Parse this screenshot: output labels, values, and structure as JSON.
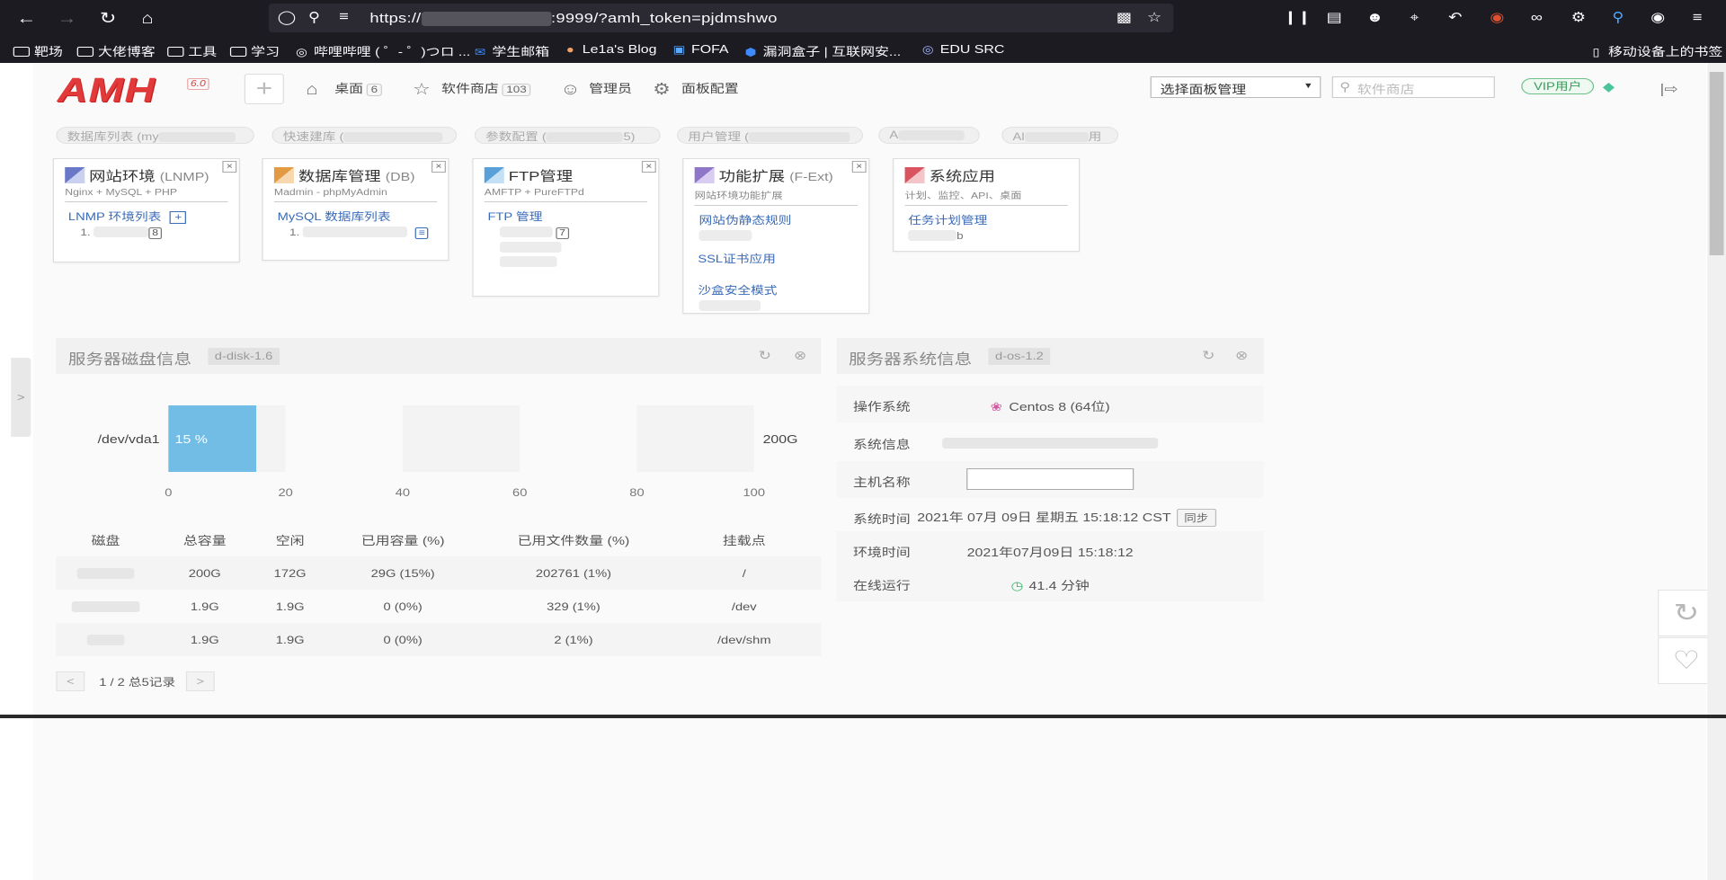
{
  "browser": {
    "url_prefix": "https://",
    "url_suffix": ":9999/?amh_token=pjdmshwo",
    "bookmarks": [
      {
        "label": "靶场",
        "icon": "folder-icon"
      },
      {
        "label": "大佬博客",
        "icon": "folder-icon"
      },
      {
        "label": "工具",
        "icon": "folder-icon"
      },
      {
        "label": "学习",
        "icon": "folder-icon"
      },
      {
        "label": "哔哩哔哩 ( ゜- ゜)つロ ...",
        "icon": "globe-icon"
      },
      {
        "label": "学生邮箱",
        "icon": "mail-icon"
      },
      {
        "label": "Le1a's Blog",
        "icon": "pig-icon"
      },
      {
        "label": "FOFA",
        "icon": "fofa-icon"
      },
      {
        "label": "漏洞盒子 | 互联网安...",
        "icon": "shield-icon"
      },
      {
        "label": "EDU SRC",
        "icon": "globe-icon"
      }
    ],
    "mobile_bookmarks": "移动设备上的书签"
  },
  "header": {
    "logo": "AMH",
    "version": "6.0",
    "nav": [
      {
        "label": "桌面",
        "count": "6",
        "icon": "home-icon"
      },
      {
        "label": "软件商店",
        "count": "103",
        "icon": "star-icon"
      },
      {
        "label": "管理员",
        "count": "",
        "icon": "user-icon"
      },
      {
        "label": "面板配置",
        "count": "",
        "icon": "gear-icon"
      }
    ],
    "panel_select": "选择面板管理",
    "search_placeholder": "软件商店",
    "vip": "VIP用户"
  },
  "quick_tabs": [
    "数据库列表 (my",
    "快速建库 (",
    "参数配置 (",
    "用户管理 (",
    "A",
    "Al"
  ],
  "quick_tabs_tail": [
    "",
    "",
    "5)",
    "",
    "",
    "用"
  ],
  "cards": [
    {
      "title": "网站环境",
      "suffix": "(LNMP)",
      "sub": "Nginx + MySQL + PHP",
      "links": [
        "LNMP 环境列表"
      ],
      "items": [
        "1.",
        "8"
      ],
      "color": "#6a78c8"
    },
    {
      "title": "数据库管理",
      "suffix": "(DB)",
      "sub": "Madmin - phpMyAdmin",
      "links": [
        "MySQL 数据库列表"
      ],
      "items": [
        "1."
      ],
      "color": "#e39a42"
    },
    {
      "title": "FTP管理",
      "suffix": "",
      "sub": "AMFTP + PureFTPd",
      "links": [
        "FTP 管理"
      ],
      "items": [
        "7"
      ],
      "color": "#5aa0d8"
    },
    {
      "title": "功能扩展",
      "suffix": "(F-Ext)",
      "sub": "网站环境功能扩展",
      "links": [
        "网站伪静态规则",
        "SSL证书应用",
        "沙盒安全模式"
      ],
      "items": [],
      "color": "#8e76c9"
    },
    {
      "title": "系统应用",
      "suffix": "",
      "sub": "计划、监控、API、桌面",
      "links": [
        "任务计划管理"
      ],
      "items": [
        "b"
      ],
      "color": "#d9545e"
    }
  ],
  "disk_block": {
    "title": "服务器磁盘信息",
    "tag": "d-disk-1.6",
    "headers": [
      "磁盘",
      "总容量",
      "空闲",
      "已用容量 (%)",
      "已用文件数量 (%)",
      "挂载点"
    ],
    "rows": [
      [
        "",
        "200G",
        "172G",
        "29G (15%)",
        "202761 (1%)",
        "/"
      ],
      [
        "",
        "1.9G",
        "1.9G",
        "0 (0%)",
        "329 (1%)",
        "/dev"
      ],
      [
        "",
        "1.9G",
        "1.9G",
        "0 (0%)",
        "2 (1%)",
        "/dev/shm"
      ]
    ],
    "pagination": "1 / 2 总5记录",
    "prev": "<",
    "next": ">"
  },
  "chart_data": {
    "type": "bar",
    "orientation": "horizontal",
    "categories": [
      "/dev/vda1"
    ],
    "values": [
      15
    ],
    "data_labels": [
      "15 %"
    ],
    "right_label": "200G",
    "xlim": [
      0,
      100
    ],
    "xticks": [
      0,
      20,
      40,
      60,
      80,
      100
    ],
    "color": "#72bde6",
    "grid": true
  },
  "os_block": {
    "title": "服务器系统信息",
    "tag": "d-os-1.2",
    "rows": [
      {
        "label": "操作系统",
        "value": "Centos 8 (64位)"
      },
      {
        "label": "系统信息",
        "value": ""
      },
      {
        "label": "主机名称",
        "value": ""
      },
      {
        "label": "系统时间",
        "value": "2021年 07月 09日 星期五 15:18:12 CST",
        "button": "同步"
      },
      {
        "label": "环境时间",
        "value": "2021年07月09日 15:18:12"
      },
      {
        "label": "在线运行",
        "value": "41.4 分钟"
      }
    ]
  },
  "sidebar_toggle": ">"
}
